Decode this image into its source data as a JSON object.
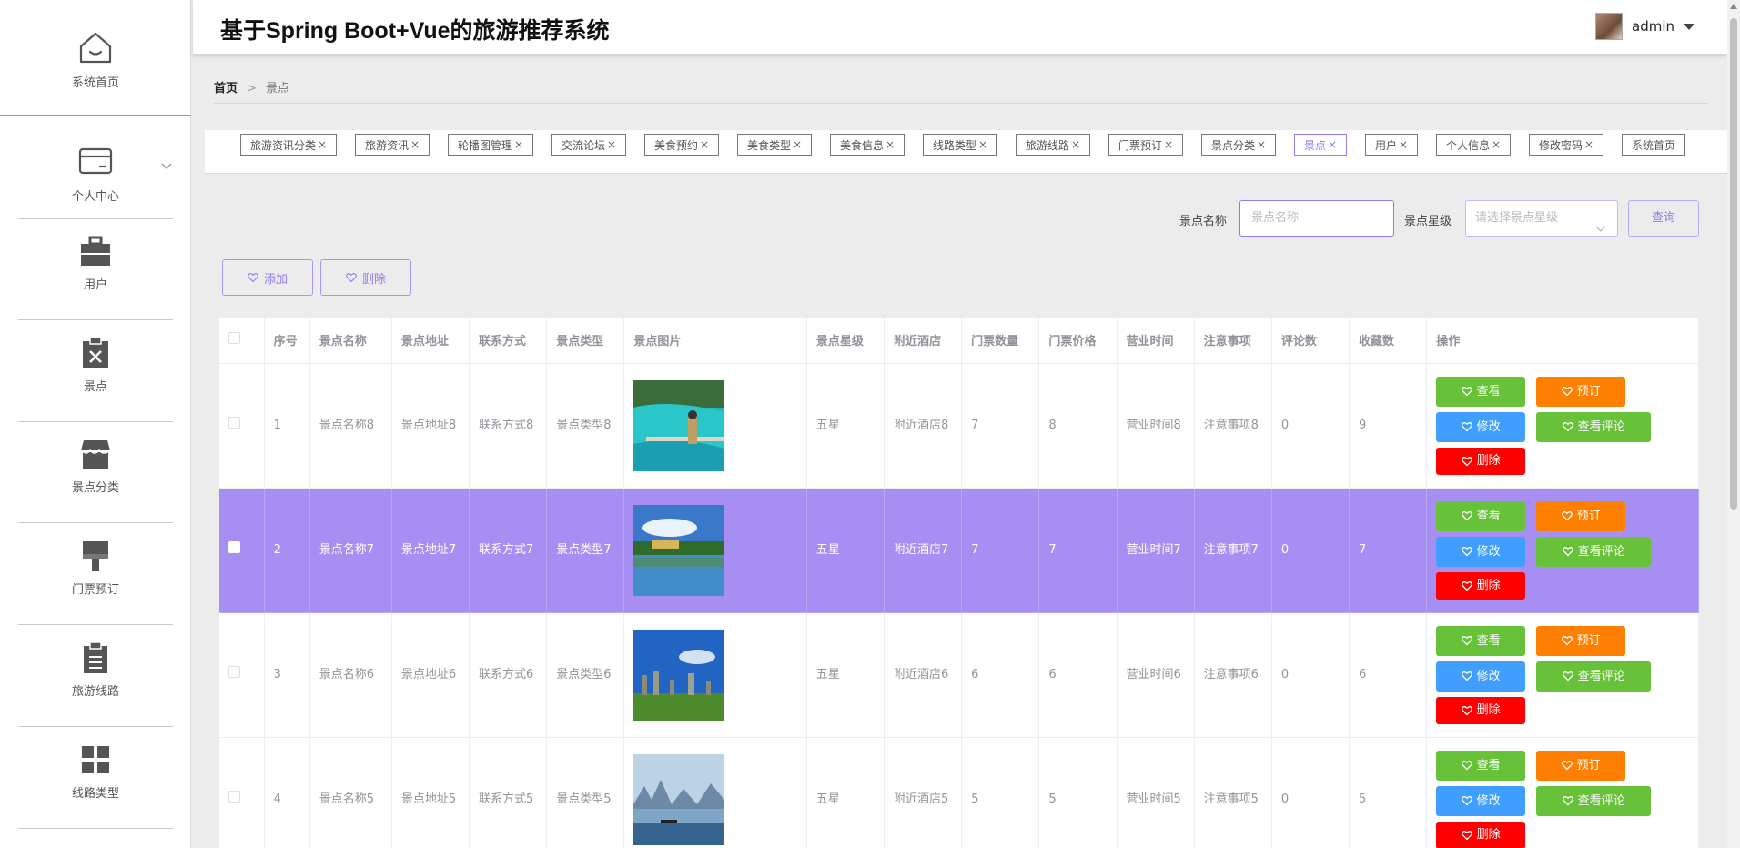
{
  "app": {
    "title": "基于Spring Boot+Vue的旅游推荐系统",
    "user": "admin"
  },
  "sidebar": {
    "items": [
      {
        "label": "系统首页",
        "icon": "home-icon"
      },
      {
        "label": "个人中心",
        "icon": "card-icon"
      },
      {
        "label": "用户",
        "icon": "briefcase-icon"
      },
      {
        "label": "景点",
        "icon": "clipboard-x-icon"
      },
      {
        "label": "景点分类",
        "icon": "shop-icon"
      },
      {
        "label": "门票预订",
        "icon": "brush-icon"
      },
      {
        "label": "旅游线路",
        "icon": "clipboard-list-icon"
      },
      {
        "label": "线路类型",
        "icon": "grid-icon"
      }
    ]
  },
  "breadcrumb": {
    "home": "首页",
    "separator": ">",
    "current": "景点"
  },
  "tags": [
    "旅游资讯分类",
    "旅游资讯",
    "轮播图管理",
    "交流论坛",
    "美食预约",
    "美食类型",
    "美食信息",
    "线路类型",
    "旅游线路",
    "门票预订",
    "景点分类",
    "景点",
    "用户",
    "个人信息",
    "修改密码",
    "系统首页"
  ],
  "tag_close": "×",
  "search": {
    "name_label": "景点名称",
    "name_placeholder": "景点名称",
    "level_label": "景点星级",
    "level_placeholder": "请选择景点星级",
    "query_button": "查询"
  },
  "actions": {
    "add": "添加",
    "delete": "删除"
  },
  "table": {
    "headers": [
      "序号",
      "景点名称",
      "景点地址",
      "联系方式",
      "景点类型",
      "景点图片",
      "景点星级",
      "附近酒店",
      "门票数量",
      "门票价格",
      "营业时间",
      "注意事项",
      "评论数",
      "收藏数",
      "操作"
    ],
    "ops": {
      "view": "查看",
      "book": "预订",
      "edit": "修改",
      "comment": "查看评论",
      "delete": "删除"
    },
    "rows": [
      {
        "index": "1",
        "name": "景点名称8",
        "address": "景点地址8",
        "contact": "联系方式8",
        "type": "景点类型8",
        "level": "五星",
        "hotel": "附近酒店8",
        "count": "7",
        "price": "8",
        "hours": "营业时间8",
        "notes": "注意事项8",
        "comments": "0",
        "favorites": "9",
        "selected": false
      },
      {
        "index": "2",
        "name": "景点名称7",
        "address": "景点地址7",
        "contact": "联系方式7",
        "type": "景点类型7",
        "level": "五星",
        "hotel": "附近酒店7",
        "count": "7",
        "price": "7",
        "hours": "营业时间7",
        "notes": "注意事项7",
        "comments": "0",
        "favorites": "7",
        "selected": true
      },
      {
        "index": "3",
        "name": "景点名称6",
        "address": "景点地址6",
        "contact": "联系方式6",
        "type": "景点类型6",
        "level": "五星",
        "hotel": "附近酒店6",
        "count": "6",
        "price": "6",
        "hours": "营业时间6",
        "notes": "注意事项6",
        "comments": "0",
        "favorites": "6",
        "selected": false
      },
      {
        "index": "4",
        "name": "景点名称5",
        "address": "景点地址5",
        "contact": "联系方式5",
        "type": "景点类型5",
        "level": "五星",
        "hotel": "附近酒店5",
        "count": "5",
        "price": "5",
        "hours": "营业时间5",
        "notes": "注意事项5",
        "comments": "0",
        "favorites": "5",
        "selected": false
      }
    ]
  },
  "colors": {
    "accent": "#8f7bf1",
    "row_highlight": "#a68ef2",
    "btn_green": "#67c23a",
    "btn_orange": "#ff7f00",
    "btn_blue": "#409eff",
    "btn_red": "#ff0000"
  }
}
